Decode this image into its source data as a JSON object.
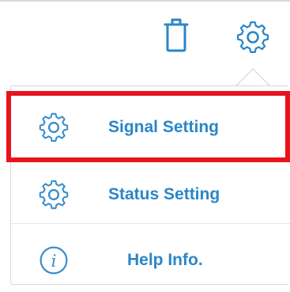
{
  "toolbar": {
    "delete_icon": "trash-icon",
    "settings_icon": "gear-icon"
  },
  "menu": {
    "items": [
      {
        "label": "Signal Setting",
        "icon": "gear-icon",
        "selected": true
      },
      {
        "label": "Status Setting",
        "icon": "gear-icon",
        "selected": false
      },
      {
        "label": "Help Info.",
        "icon": "info-icon",
        "selected": false
      }
    ]
  },
  "colors": {
    "accent": "#2a86c7",
    "highlight": "#e8141c",
    "icon_gray": "#3a8dcc",
    "border": "#d6d6d6"
  }
}
